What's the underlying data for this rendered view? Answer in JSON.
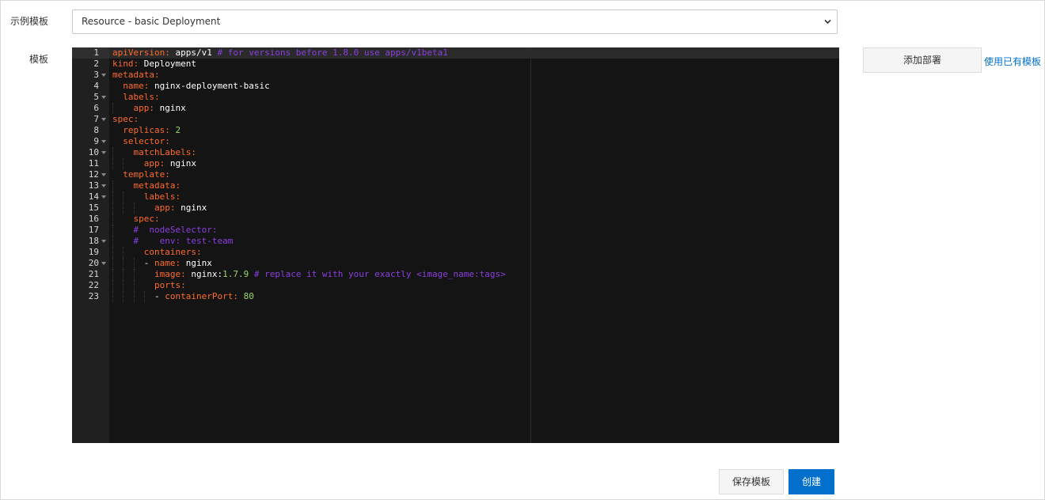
{
  "form": {
    "template_select_label": "示例模板",
    "template_select_value": "Resource - basic Deployment",
    "template_label": "模板"
  },
  "editor": {
    "lines": [
      {
        "n": "1",
        "fold": false,
        "tokens": [
          [
            "k",
            "apiVersion:"
          ],
          [
            "v",
            " apps/v1 "
          ],
          [
            "c",
            "# for versions before 1.8.0 use apps/v1beta1"
          ]
        ]
      },
      {
        "n": "2",
        "fold": false,
        "tokens": [
          [
            "k",
            "kind:"
          ],
          [
            "v",
            " Deployment"
          ]
        ]
      },
      {
        "n": "3",
        "fold": true,
        "tokens": [
          [
            "k",
            "metadata:"
          ]
        ]
      },
      {
        "n": "4",
        "fold": false,
        "tokens": [
          [
            "v",
            "  "
          ],
          [
            "k",
            "name:"
          ],
          [
            "v",
            " nginx-deployment-basic"
          ]
        ]
      },
      {
        "n": "5",
        "fold": true,
        "tokens": [
          [
            "v",
            "  "
          ],
          [
            "k",
            "labels:"
          ]
        ]
      },
      {
        "n": "6",
        "fold": false,
        "tokens": [
          [
            "v",
            "    "
          ],
          [
            "k",
            "app:"
          ],
          [
            "v",
            " nginx"
          ]
        ]
      },
      {
        "n": "7",
        "fold": true,
        "tokens": [
          [
            "k",
            "spec:"
          ]
        ]
      },
      {
        "n": "8",
        "fold": false,
        "tokens": [
          [
            "v",
            "  "
          ],
          [
            "k",
            "replicas:"
          ],
          [
            "v",
            " "
          ],
          [
            "n",
            "2"
          ]
        ]
      },
      {
        "n": "9",
        "fold": true,
        "tokens": [
          [
            "v",
            "  "
          ],
          [
            "k",
            "selector:"
          ]
        ]
      },
      {
        "n": "10",
        "fold": true,
        "tokens": [
          [
            "v",
            "    "
          ],
          [
            "k",
            "matchLabels:"
          ]
        ]
      },
      {
        "n": "11",
        "fold": false,
        "tokens": [
          [
            "v",
            "      "
          ],
          [
            "k",
            "app:"
          ],
          [
            "v",
            " nginx"
          ]
        ]
      },
      {
        "n": "12",
        "fold": true,
        "tokens": [
          [
            "v",
            "  "
          ],
          [
            "k",
            "template:"
          ]
        ]
      },
      {
        "n": "13",
        "fold": true,
        "tokens": [
          [
            "v",
            "    "
          ],
          [
            "k",
            "metadata:"
          ]
        ]
      },
      {
        "n": "14",
        "fold": true,
        "tokens": [
          [
            "v",
            "      "
          ],
          [
            "k",
            "labels:"
          ]
        ]
      },
      {
        "n": "15",
        "fold": false,
        "tokens": [
          [
            "v",
            "        "
          ],
          [
            "k",
            "app:"
          ],
          [
            "v",
            " nginx"
          ]
        ]
      },
      {
        "n": "16",
        "fold": false,
        "tokens": [
          [
            "v",
            "    "
          ],
          [
            "k",
            "spec:"
          ]
        ]
      },
      {
        "n": "17",
        "fold": false,
        "tokens": [
          [
            "v",
            "    "
          ],
          [
            "c",
            "#  nodeSelector:"
          ]
        ]
      },
      {
        "n": "18",
        "fold": true,
        "tokens": [
          [
            "v",
            "    "
          ],
          [
            "c",
            "#    env: test-team"
          ]
        ]
      },
      {
        "n": "19",
        "fold": false,
        "tokens": [
          [
            "v",
            "      "
          ],
          [
            "k",
            "containers:"
          ]
        ]
      },
      {
        "n": "20",
        "fold": true,
        "tokens": [
          [
            "v",
            "      - "
          ],
          [
            "k",
            "name:"
          ],
          [
            "v",
            " nginx"
          ]
        ]
      },
      {
        "n": "21",
        "fold": false,
        "tokens": [
          [
            "v",
            "        "
          ],
          [
            "k",
            "image:"
          ],
          [
            "v",
            " nginx:"
          ],
          [
            "n",
            "1.7.9"
          ],
          [
            "v",
            " "
          ],
          [
            "c",
            "# replace it with your exactly <image_name:tags>"
          ]
        ]
      },
      {
        "n": "22",
        "fold": false,
        "tokens": [
          [
            "v",
            "        "
          ],
          [
            "k",
            "ports:"
          ]
        ]
      },
      {
        "n": "23",
        "fold": false,
        "tokens": [
          [
            "v",
            "        - "
          ],
          [
            "k",
            "containerPort:"
          ],
          [
            "v",
            " "
          ],
          [
            "n",
            "80"
          ]
        ]
      }
    ]
  },
  "actions": {
    "add_deployment": "添加部署",
    "use_existing": "使用已有模板",
    "save_template": "保存模板",
    "create": "创建"
  },
  "colors": {
    "primary": "#0070cc",
    "editor_bg": "#141414",
    "yaml_key": "#ff6b2b",
    "yaml_comment": "#8b3fe0",
    "yaml_number": "#9bd86a"
  }
}
